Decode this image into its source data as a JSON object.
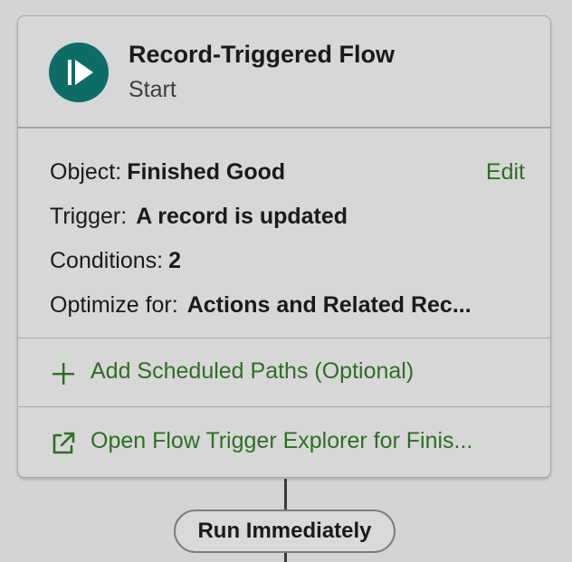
{
  "start_element": {
    "title": "Record-Triggered Flow",
    "subtitle": "Start",
    "icon": "play-icon",
    "icon_color": "#0d6c66"
  },
  "details": {
    "object_label": "Object:",
    "object_value": "Finished Good",
    "edit_label": "Edit",
    "trigger_label": "Trigger:",
    "trigger_value": "A record is updated",
    "conditions_label": "Conditions:",
    "conditions_value": "2",
    "optimize_label": "Optimize for:",
    "optimize_value": "Actions and Related Rec..."
  },
  "actions": {
    "scheduled_paths": {
      "label": "Add Scheduled Paths (Optional)",
      "icon": "plus-icon"
    },
    "trigger_explorer": {
      "label": "Open Flow Trigger Explorer for Finis...",
      "icon": "external-link-icon"
    }
  },
  "path_pill": {
    "label": "Run Immediately"
  },
  "colors": {
    "link": "#2e6e24",
    "background": "#d4d4d4",
    "card_border": "#a9a9a9"
  }
}
